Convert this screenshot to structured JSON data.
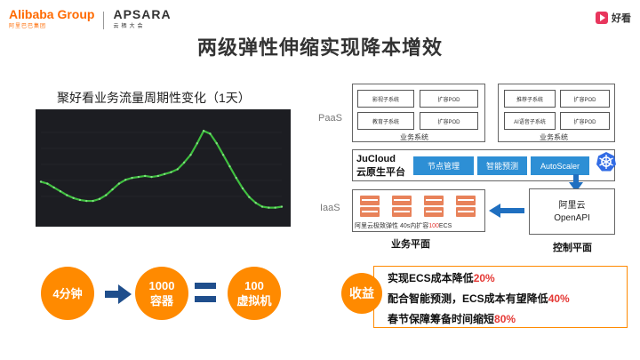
{
  "header": {
    "logo_left": "Alibaba Group",
    "logo_left_sub": "阿里巴巴集团",
    "logo_mid": "APSARA",
    "logo_mid_sub": "云栖大会",
    "logo_right": "好看"
  },
  "title": "两级弹性伸缩实现降本增效",
  "chart_section": {
    "title": "聚好看业务流量周期性变化（1天）"
  },
  "chart_data": {
    "type": "line",
    "title": "聚好看业务流量周期性变化（1天）",
    "xlabel": "",
    "ylabel": "",
    "grid": true,
    "series": [
      {
        "values": [
          0.32,
          0.3,
          0.26,
          0.22,
          0.18,
          0.15,
          0.13,
          0.12,
          0.12,
          0.14,
          0.18,
          0.24,
          0.3,
          0.34,
          0.36,
          0.37,
          0.38,
          0.37,
          0.38,
          0.4,
          0.42,
          0.45,
          0.52,
          0.6,
          0.72,
          0.85,
          0.82,
          0.72,
          0.6,
          0.48,
          0.36,
          0.25,
          0.16,
          0.1,
          0.06,
          0.05,
          0.05,
          0.06
        ]
      }
    ],
    "colors": {
      "line": "#3fbf3f",
      "background": "#1c1d22"
    }
  },
  "arch": {
    "paas_label": "PaaS",
    "iaas_label": "IaaS",
    "left_group": {
      "items": [
        {
          "name": "影视子系统",
          "action": "扩容POD"
        },
        {
          "name": "教育子系统",
          "action": "扩容POD"
        }
      ],
      "caption": "业务系统"
    },
    "right_group": {
      "items": [
        {
          "name": "推荐子系统",
          "action": "扩容POD"
        },
        {
          "name": "AI语音子系统",
          "action": "扩容POD"
        }
      ],
      "caption": "业务系统"
    },
    "platform": {
      "name_line1": "JuCloud",
      "name_line2": "云原生平台",
      "buttons": [
        "节点管理",
        "智能预测",
        "AutoScaler"
      ]
    },
    "biz_plane": {
      "caption_pre": "阿里云极致弹性 40s内扩容",
      "caption_num": "100",
      "caption_post": "ECS",
      "label": "业务平面"
    },
    "ctrl_plane": {
      "line1": "阿里云",
      "line2": "OpenAPI",
      "label": "控制平面"
    }
  },
  "flow": {
    "step1": "4分钟",
    "step2_line1": "1000",
    "step2_line2": "容器",
    "step3_line1": "100",
    "step3_line2": "虚拟机"
  },
  "benefit": {
    "label": "收益",
    "lines": [
      {
        "text": "实现ECS成本降低",
        "highlight": "20%"
      },
      {
        "text": "配合智能预测，ECS成本有望降低",
        "highlight": "40%"
      },
      {
        "text": "春节保障筹备时间缩短",
        "highlight": "80%"
      }
    ]
  }
}
